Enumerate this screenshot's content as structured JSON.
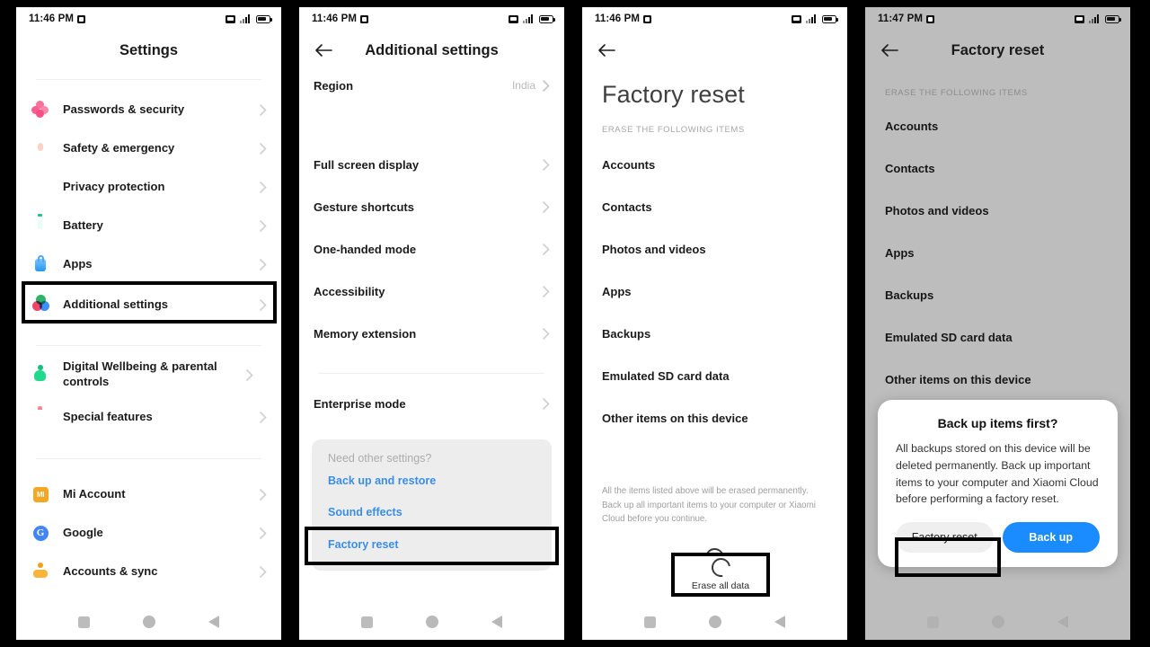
{
  "panels": [
    {
      "statusbar": {
        "time": "11:46 PM",
        "icons": [
          "alarm-icon",
          "sim-icon",
          "signal-icon",
          "battery-icon"
        ]
      },
      "header": {
        "title": "Settings"
      },
      "groups": [
        {
          "items": [
            {
              "label": "Passwords & security",
              "icon": "passwords-security-icon"
            },
            {
              "label": "Safety & emergency",
              "icon": "safety-emergency-icon"
            },
            {
              "label": "Privacy protection",
              "icon": "privacy-protection-icon"
            },
            {
              "label": "Battery",
              "icon": "battery-icon"
            },
            {
              "label": "Apps",
              "icon": "apps-icon"
            },
            {
              "label": "Additional settings",
              "icon": "additional-settings-icon",
              "highlighted": true
            }
          ]
        },
        {
          "items": [
            {
              "label": "Digital Wellbeing & parental controls",
              "icon": "digital-wellbeing-icon"
            },
            {
              "label": "Special features",
              "icon": "special-features-icon"
            }
          ]
        },
        {
          "items": [
            {
              "label": "Mi Account",
              "icon": "mi-account-icon"
            },
            {
              "label": "Google",
              "icon": "google-icon"
            },
            {
              "label": "Accounts & sync",
              "icon": "accounts-sync-icon"
            }
          ]
        }
      ]
    },
    {
      "statusbar": {
        "time": "11:46 PM"
      },
      "header": {
        "title": "Additional settings",
        "back": "back-arrow"
      },
      "region": {
        "label": "Region",
        "value": "India"
      },
      "items": [
        {
          "label": "Full screen display"
        },
        {
          "label": "Gesture shortcuts"
        },
        {
          "label": "One-handed mode"
        },
        {
          "label": "Accessibility"
        },
        {
          "label": "Memory extension"
        }
      ],
      "items2": [
        {
          "label": "Enterprise mode"
        }
      ],
      "need_card": {
        "title": "Need other settings?",
        "links": [
          {
            "label": "Back up and restore"
          },
          {
            "label": "Sound effects"
          },
          {
            "label": "Factory reset",
            "highlighted": true
          }
        ]
      }
    },
    {
      "statusbar": {
        "time": "11:46 PM"
      },
      "header": {
        "back": "back-arrow"
      },
      "title": "Factory reset",
      "caption": "ERASE THE FOLLOWING ITEMS",
      "items": [
        "Accounts",
        "Contacts",
        "Photos and videos",
        "Apps",
        "Backups",
        "Emulated SD card data",
        "Other items on this device"
      ],
      "footnote": "All the items listed above will be erased permanently. Back up all important items to your computer or Xiaomi Cloud before you continue.",
      "erase_button": {
        "label": "Erase all data",
        "icon": "spinner-icon"
      }
    },
    {
      "statusbar": {
        "time": "11:47 PM"
      },
      "header": {
        "title": "Factory reset",
        "back": "back-arrow"
      },
      "caption": "ERASE THE FOLLOWING ITEMS",
      "items": [
        "Accounts",
        "Contacts",
        "Photos and videos",
        "Apps",
        "Backups",
        "Emulated SD card data",
        "Other items on this device"
      ],
      "dialog": {
        "title": "Back up items first?",
        "body": "All backups stored on this device will be deleted permanently. Back up important items to your computer and Xiaomi Cloud before performing a factory reset.",
        "secondary_button": "Factory reset",
        "primary_button": "Back up",
        "secondary_highlighted": true
      }
    }
  ],
  "navbar": {
    "recents": "recents-button",
    "home": "home-button",
    "back": "back-button"
  },
  "colors": {
    "link": "#3a8ee6",
    "primary": "#1a8cff",
    "highlight": "#000000",
    "dim": "#bdbdbd"
  }
}
